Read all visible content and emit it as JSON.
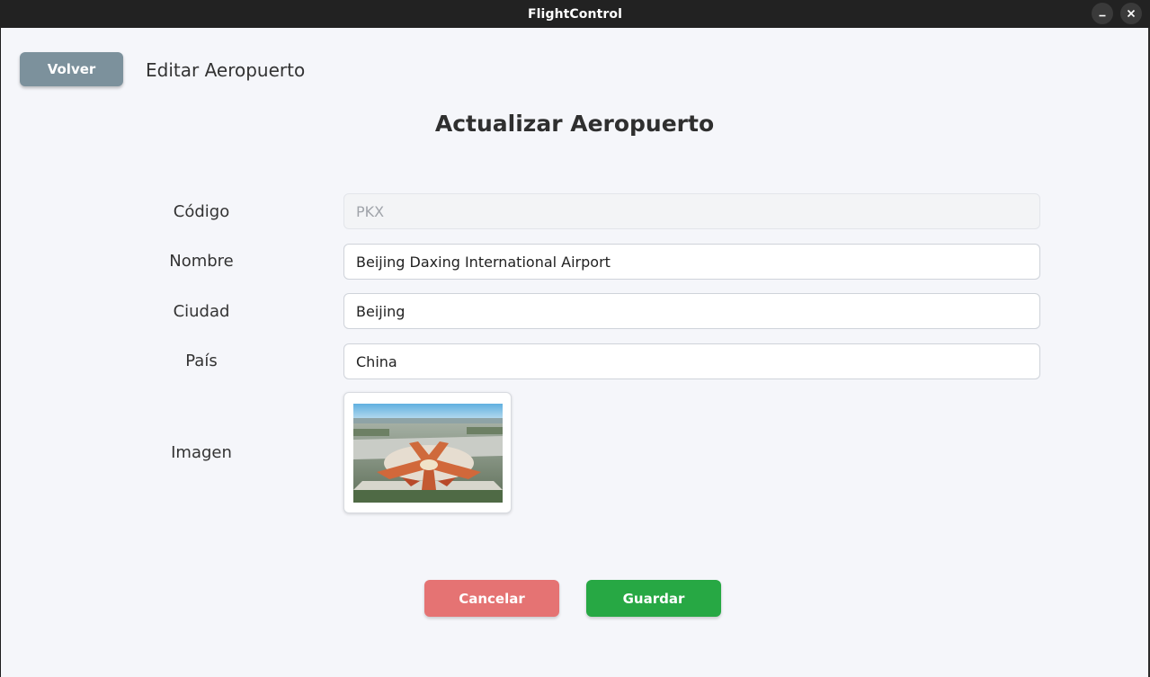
{
  "window": {
    "title": "FlightControl",
    "minimize_icon": "minimize-icon",
    "close_icon": "close-icon"
  },
  "header": {
    "back_label": "Volver",
    "page_title": "Editar Aeropuerto"
  },
  "form": {
    "title": "Actualizar Aeropuerto",
    "fields": [
      {
        "label": "Código",
        "value": "PKX",
        "disabled": true
      },
      {
        "label": "Nombre",
        "value": "Beijing Daxing International Airport"
      },
      {
        "label": "Ciudad",
        "value": "Beijing"
      },
      {
        "label": "País",
        "value": "China"
      }
    ],
    "image_label": "Imagen",
    "image_alt": "airport-photo"
  },
  "actions": {
    "cancel_label": "Cancelar",
    "save_label": "Guardar"
  },
  "colors": {
    "back_button": "#7c919c",
    "cancel_button": "#e57373",
    "save_button": "#27a844",
    "background": "#f5f6fa"
  }
}
